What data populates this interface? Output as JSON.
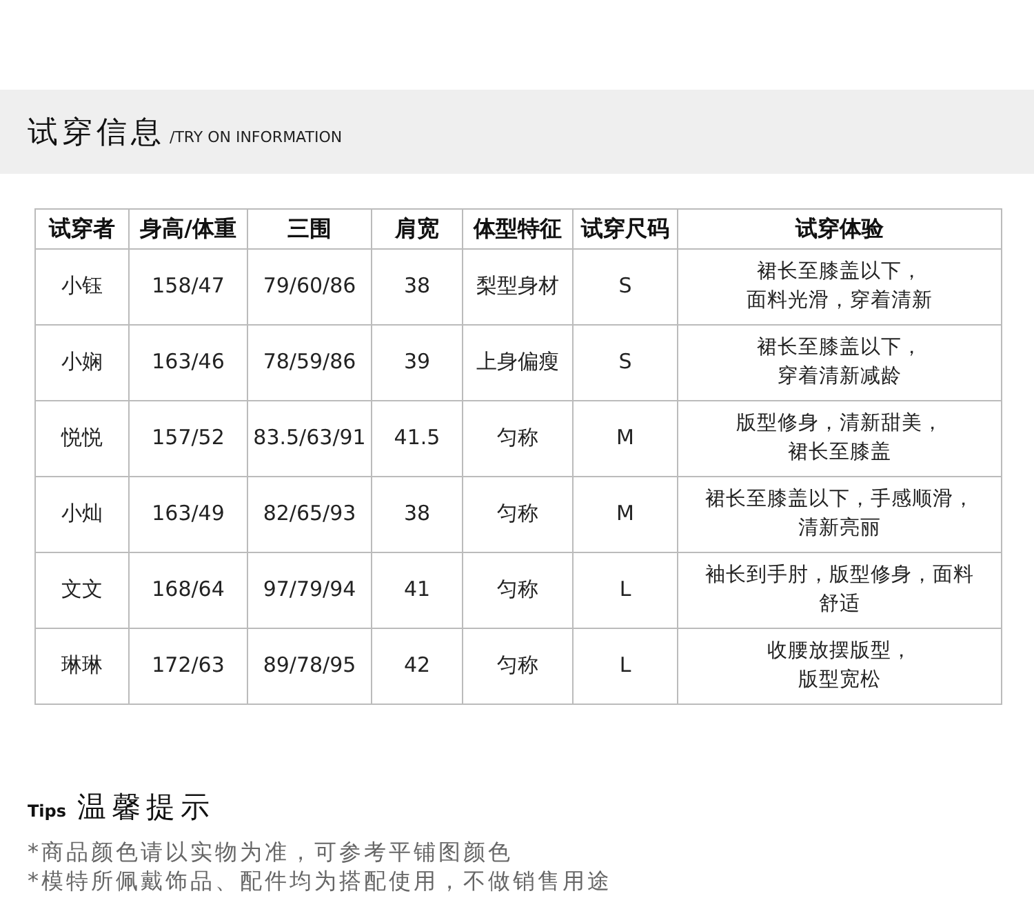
{
  "header": {
    "title": "试穿信息",
    "subtitle": "/TRY ON INFORMATION"
  },
  "table": {
    "columns": [
      "试穿者",
      "身高/体重",
      "三围",
      "肩宽",
      "体型特征",
      "试穿尺码",
      "试穿体验"
    ],
    "rows": [
      [
        "小钰",
        "158/47",
        "79/60/86",
        "38",
        "梨型身材",
        "S",
        [
          "裙长至膝盖以下，",
          "面料光滑，穿着清新"
        ]
      ],
      [
        "小娴",
        "163/46",
        "78/59/86",
        "39",
        "上身偏瘦",
        "S",
        [
          "裙长至膝盖以下，",
          "穿着清新减龄"
        ]
      ],
      [
        "悦悦",
        "157/52",
        "83.5/63/91",
        "41.5",
        "匀称",
        "M",
        [
          "版型修身，清新甜美，",
          "裙长至膝盖"
        ]
      ],
      [
        "小灿",
        "163/49",
        "82/65/93",
        "38",
        "匀称",
        "M",
        [
          "裙长至膝盖以下，手感顺滑，",
          "清新亮丽"
        ]
      ],
      [
        "文文",
        "168/64",
        "97/79/94",
        "41",
        "匀称",
        "L",
        [
          "袖长到手肘，版型修身，面料",
          "舒适"
        ]
      ],
      [
        "琳琳",
        "172/63",
        "89/78/95",
        "42",
        "匀称",
        "L",
        [
          "收腰放摆版型，",
          "版型宽松"
        ]
      ]
    ]
  },
  "tips": {
    "label": "Tips",
    "title": "温馨提示",
    "notes": [
      "*商品颜色请以实物为准，可参考平铺图颜色",
      "*模特所佩戴饰品、配件均为搭配使用，不做销售用途"
    ]
  }
}
